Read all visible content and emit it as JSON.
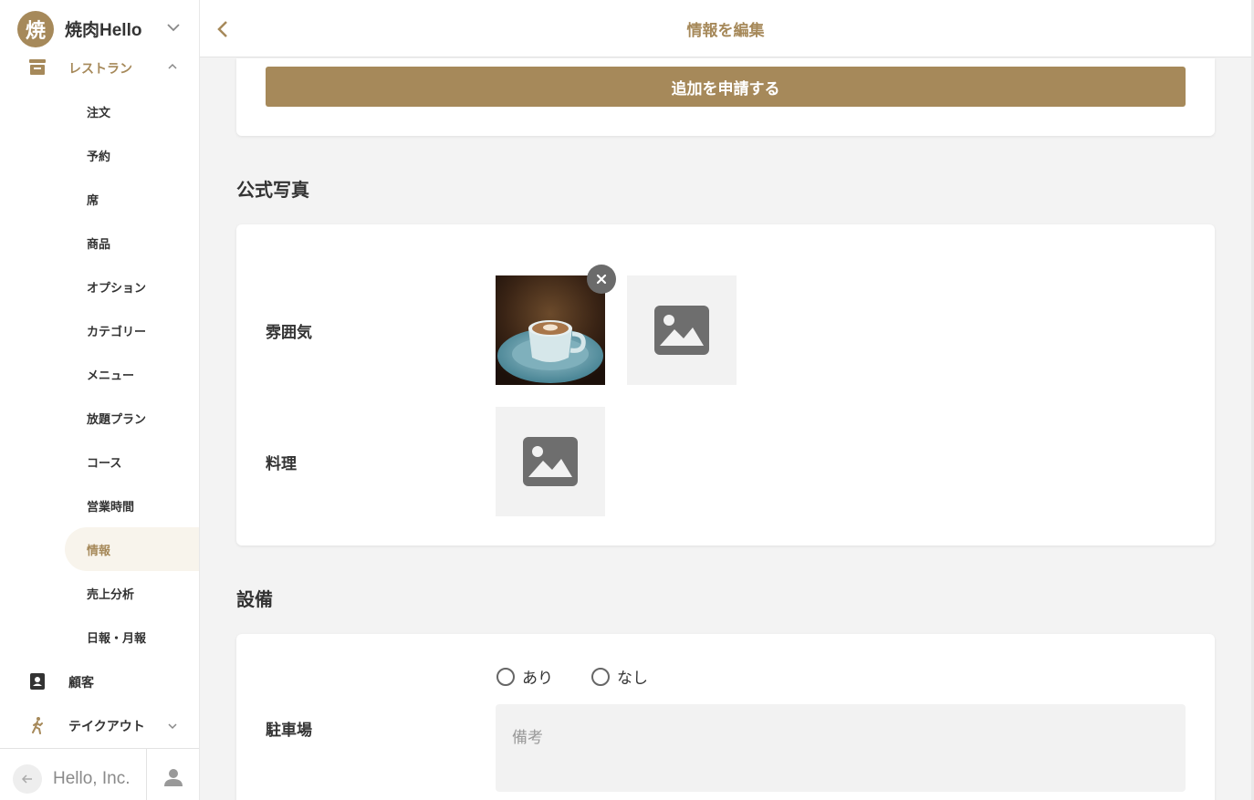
{
  "brand": {
    "logo_char": "焼",
    "name": "焼肉Hello"
  },
  "sidebar": {
    "group_label": "レストラン",
    "subitems": [
      {
        "label": "注文"
      },
      {
        "label": "予約"
      },
      {
        "label": "席"
      },
      {
        "label": "商品"
      },
      {
        "label": "オプション"
      },
      {
        "label": "カテゴリー"
      },
      {
        "label": "メニュー"
      },
      {
        "label": "放題プラン"
      },
      {
        "label": "コース"
      },
      {
        "label": "営業時間"
      },
      {
        "label": "情報",
        "active": true
      },
      {
        "label": "売上分析"
      },
      {
        "label": "日報・月報"
      }
    ],
    "customers_label": "顧客",
    "takeout_label": "テイクアウト",
    "footer": {
      "company": "Hello, Inc."
    }
  },
  "header": {
    "title": "情報を編集"
  },
  "submit": {
    "label": "追加を申請する"
  },
  "photos_section": {
    "title": "公式写真",
    "atmosphere_label": "雰囲気",
    "cuisine_label": "料理"
  },
  "facilities_section": {
    "title": "設備",
    "parking_label": "駐車場",
    "option_yes": "あり",
    "option_no": "なし",
    "notes_placeholder": "備考"
  },
  "colors": {
    "accent": "#a6895a",
    "active_bg": "#f8f4ec"
  }
}
